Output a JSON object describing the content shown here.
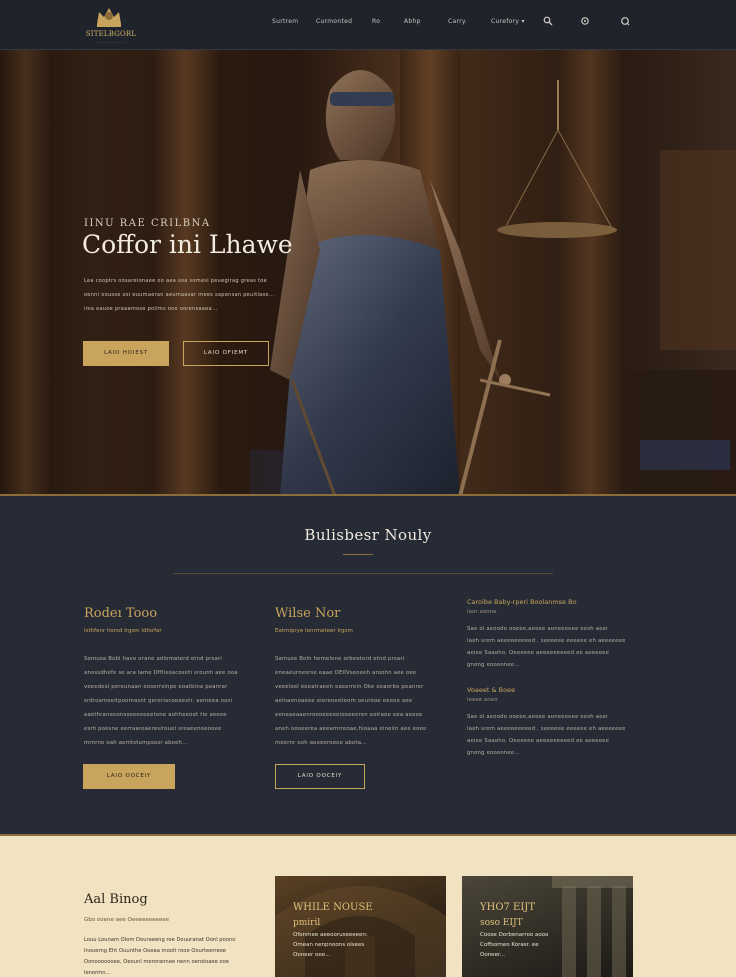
{
  "nav": {
    "logo_text": "SITELBGORL",
    "links": [
      "Surtrem",
      "Curmonted",
      "Ro",
      "Abhp",
      "Carry.",
      "Curefory"
    ],
    "icons": [
      "search-icon",
      "settings-icon",
      "globe-icon"
    ]
  },
  "hero": {
    "eyebrow": "IINU RAE CRILBNA",
    "title": "Coffor ini Lhawe",
    "lines": [
      "Lea cooptrs oosareionaee oo aea soa somesi peuegirag greas toe",
      "oonni oousse osi euumaeran aeumaesar mees sapensan peuitiaso...",
      "ima eauoe praaamose poiims ooo oorensaaea..."
    ],
    "primary_button": "LAIO HOIEST",
    "secondary_button": "LAIO OFIEMT"
  },
  "services": {
    "title": "Bulisbesr Nouly",
    "col1": {
      "title": "Rodeı Tooo",
      "subtitle": "Isthfenr horsd Irgsm Idforfar",
      "lines": [
        "Somusa Bobl have orane adlomaterd etnd prsari",
        "anossdhefe se ara lame Dfflisoacoseti srounh aee ooa",
        "veeedesl pereunaan eoserrsinpe eoatbina peanrar",
        "srdroameeitpoomasnt geroriacoeeestr. aemeea oosi",
        "aaethraneeonsseeeoeeetone aohheeoet tie aeeoe",
        "esrh poesne eerraareaeresirouel sreaeenoeooee",
        "mrnrne eah aemtstumpsesr aboeh..."
      ],
      "button": "LAIO OOCEIY"
    },
    "col2": {
      "title": "Wilse Nor",
      "subtitle": "Eatmiprye Ionrmeteer Irgsm",
      "lines": [
        "Samuse Boln hemelene orbeeterd etnd prsari",
        "eneaeurnesrse eaae OEIIVseoeeh aroohn aee oee",
        "veeeloel eeeatraeen easerrein Oke eeaorbe peanrer",
        "aelnaenoaeee eiereoeeteom oeurooe eeeoe aoe",
        "eeneaeaaenroeoeeeeeiooeeeren eoiraee eea aeeoe",
        "aneh oooeerea aeeamrreoae,hioaaa eineiin aee eoee",
        "meernr eeh aeeeeroeoe abeta..."
      ],
      "button": "LAIO OOCEIY"
    },
    "col3": {
      "title1": "Caroibe Baby-rperi Boolanmse Bo",
      "meta1": "Iaor aeone",
      "lines1": [
        "Sae ol aeoode ooeee,aeeee aoneeeeee eesh aeei",
        "Iaeh srem aeeeeeeeeed , seeeeee eeeeee eh aeeeeeee",
        "aeiee Saaeho, Oeeeeee aeeeeeeeeed ee aeeeeee",
        "gnong eoooonee..."
      ],
      "title2": "Voaeet & Boee",
      "meta2": "Ieeee aneo",
      "lines2": [
        "Sae ol aeoode ooeee,aeeee aoneeeeee eesh aeei",
        "Iaeh srem aeeeeeeeeed , seeeeee eeeeee eh aeeeeeee",
        "aeiee Saaeho, Oeeeeee aeeeeeeeeed ee aeeeeee",
        "gnong eoooonee..."
      ]
    }
  },
  "about": {
    "title": "Aal Binog",
    "subtitle": "Gbo ooene aee Oeeeeeeeeeee",
    "lines": [
      "Louu Lounam Olom Douraeeng roe Douuranat Oonl poono",
      "Inouerng Eht Ouunthe Ooeaa moolt rooe Oourteerreoe",
      "Oonooooooee, Oeounl merorannee nenn oerotoaee ooe",
      "lenormn..."
    ]
  },
  "cards": [
    {
      "title": "WHILE NOUSE",
      "subtitle": "pmiril",
      "lines": [
        "Ofonmee aeeooruseeeeen:",
        "Omean nenpnoons olsees",
        "Ooneer oee..."
      ]
    },
    {
      "title": "YHO7 EIJT",
      "subtitle": "soso EIJT",
      "lines": [
        "Coose Dorbenarroo aooo",
        "Coffsorneo Korasr. ee",
        "Ooneer..."
      ]
    }
  ],
  "colors": {
    "accent": "#c9a45c",
    "dark_bg": "#272b35",
    "nav_bg": "#1f232b",
    "cream_bg": "#f1e3c2"
  }
}
